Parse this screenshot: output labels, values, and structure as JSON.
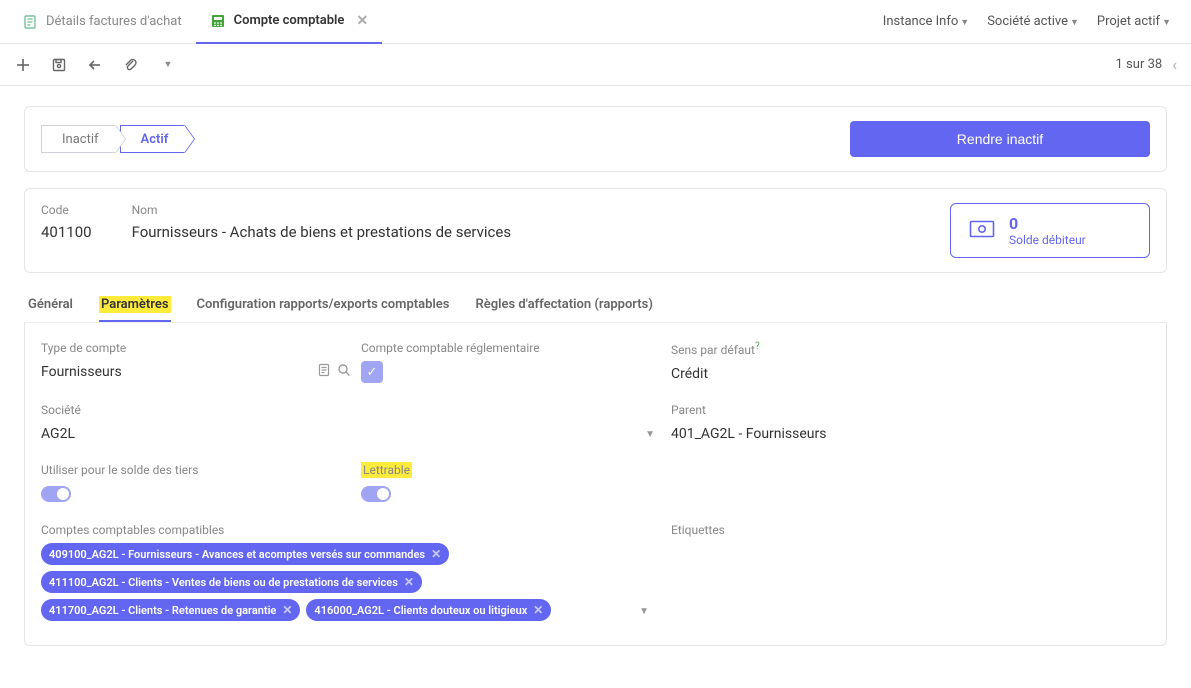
{
  "tabs": {
    "items": [
      {
        "label": "Détails factures d'achat",
        "icon": "doc",
        "active": false
      },
      {
        "label": "Compte comptable",
        "icon": "calc",
        "active": true
      }
    ]
  },
  "top_menu": {
    "instance": "Instance Info",
    "company": "Société active",
    "project": "Projet actif"
  },
  "pager": {
    "text": "1 sur 38"
  },
  "status": {
    "inactive": "Inactif",
    "active": "Actif",
    "button": "Rendre inactif"
  },
  "header": {
    "code_label": "Code",
    "code_value": "401100",
    "name_label": "Nom",
    "name_value": "Fournisseurs - Achats de biens et prestations de services",
    "balance_value": "0",
    "balance_label": "Solde débiteur"
  },
  "subtabs": {
    "general": "Général",
    "params": "Paramètres",
    "config": "Configuration rapports/exports comptables",
    "rules": "Règles d'affectation (rapports)"
  },
  "form": {
    "account_type_label": "Type de compte",
    "account_type_value": "Fournisseurs",
    "reg_account_label": "Compte comptable réglementaire",
    "default_dir_label": "Sens par défaut",
    "default_dir_value": "Crédit",
    "company_label": "Société",
    "company_value": "AG2L",
    "parent_label": "Parent",
    "parent_value": "401_AG2L - Fournisseurs",
    "third_balance_label": "Utiliser pour le solde des tiers",
    "letterable_label": "Lettrable",
    "compatible_label": "Comptes comptables compatibles",
    "tags_label": "Etiquettes",
    "chips": [
      "409100_AG2L - Fournisseurs - Avances et acomptes versés sur commandes",
      "411100_AG2L - Clients - Ventes de biens ou de prestations de services",
      "411700_AG2L - Clients - Retenues de garantie",
      "416000_AG2L - Clients douteux ou litigieux"
    ]
  }
}
